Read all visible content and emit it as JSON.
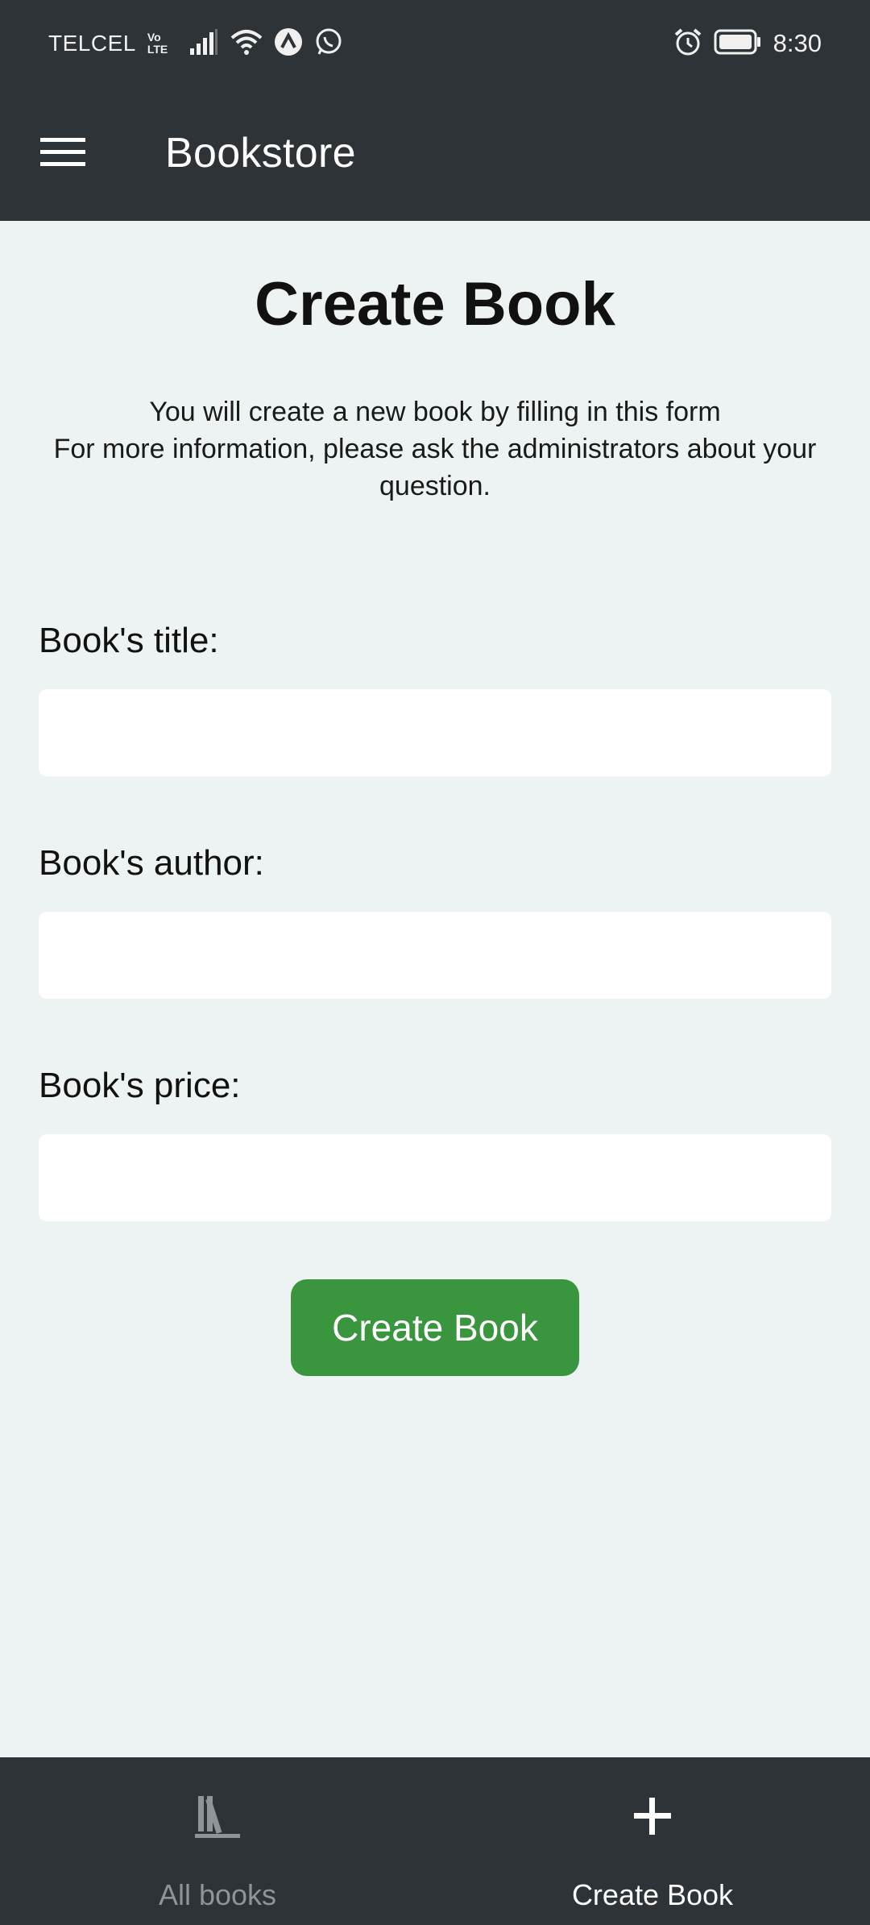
{
  "status_bar": {
    "carrier": "TELCEL",
    "volte_top": "Vo",
    "volte_bottom": "LTE",
    "time": "8:30"
  },
  "app_bar": {
    "title": "Bookstore"
  },
  "main": {
    "title": "Create Book",
    "intro_line1": "You will create a new book by filling in this form",
    "intro_line2": "For more information, please ask the administrators about your question.",
    "fields": [
      {
        "label": "Book's title:",
        "value": ""
      },
      {
        "label": "Book's author:",
        "value": ""
      },
      {
        "label": "Book's price:",
        "value": ""
      }
    ],
    "submit_label": "Create Book"
  },
  "bottom_nav": {
    "items": [
      {
        "label": "All books",
        "icon": "books-icon",
        "active": false
      },
      {
        "label": "Create Book",
        "icon": "plus-icon",
        "active": true
      }
    ]
  },
  "colors": {
    "bar_background": "#2d3336",
    "page_background": "#edf2f2",
    "primary_button": "#3a963e",
    "nav_inactive": "#8f9596",
    "nav_active": "#ffffff"
  }
}
